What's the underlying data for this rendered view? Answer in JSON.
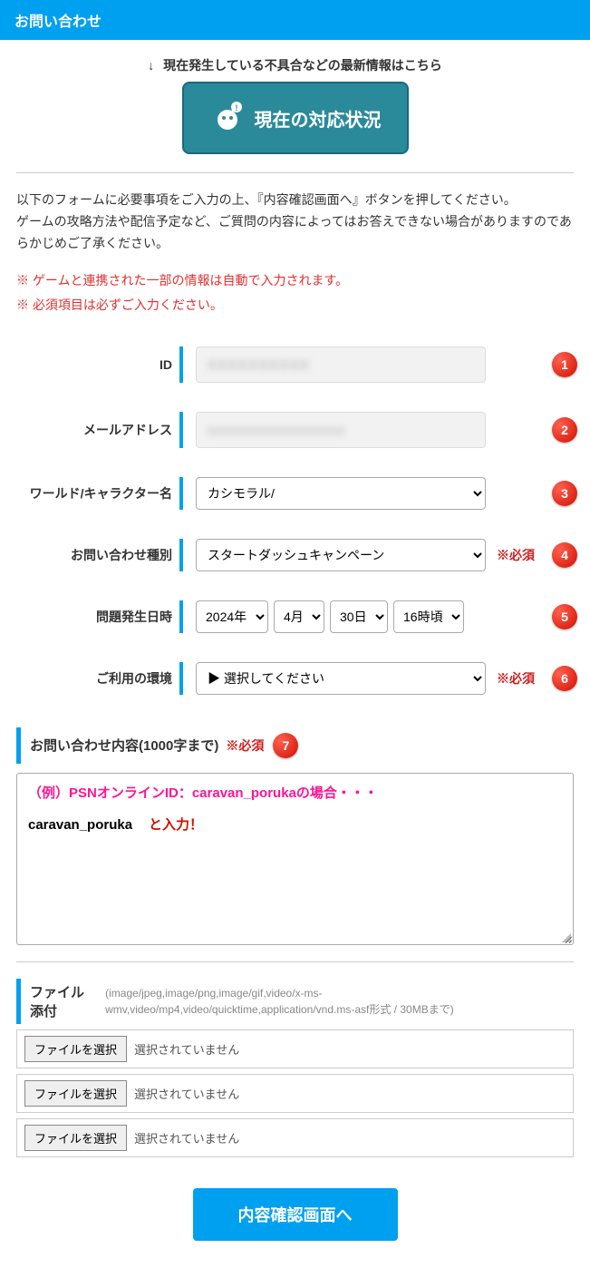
{
  "header": {
    "title": "お問い合わせ"
  },
  "notice": {
    "arrow": "↓",
    "text": "現在発生している不具合などの最新情報はこちら",
    "button": "現在の対応状況"
  },
  "instructions": {
    "line1": "以下のフォームに必要事項をご入力の上、『内容確認画面へ』ボタンを押してください。",
    "line2": "ゲームの攻略方法や配信予定など、ご質問の内容によってはお答えできない場合がありますのであらかじめご了承ください。"
  },
  "red_notes": {
    "line1": "※ ゲームと連携された一部の情報は自動で入力されます。",
    "line2": "※ 必須項目は必ずご入力ください。"
  },
  "fields": {
    "id": {
      "label": "ID",
      "value": "XXXXXXXXXX",
      "badge": "1"
    },
    "email": {
      "label": "メールアドレス",
      "value": "xxxxxxxxxxxxxxxxx",
      "badge": "2"
    },
    "world": {
      "label": "ワールド/キャラクター名",
      "value": "カシモラル/",
      "badge": "3"
    },
    "category": {
      "label": "お問い合わせ種別",
      "value": "スタートダッシュキャンペーン",
      "required": "※必須",
      "badge": "4"
    },
    "date": {
      "label": "問題発生日時",
      "year": "2024年",
      "month": "4月",
      "day": "30日",
      "hour": "16時頃",
      "badge": "5"
    },
    "env": {
      "label": "ご利用の環境",
      "value": "▶ 選択してください",
      "required": "※必須",
      "badge": "6"
    }
  },
  "content_section": {
    "title": "お問い合わせ内容(1000字まで)",
    "required": "※必須",
    "badge": "7",
    "example_prefix": "（例）PSNオンラインID：caravan_porukaの場合・・・",
    "example_value": "caravan_poruka",
    "example_hint": "と入力！"
  },
  "attach_section": {
    "title": "ファイル添付",
    "hint": "(image/jpeg,image/png,image/gif,video/x-ms-wmv,video/mp4,video/quicktime,application/vnd.ms-asf形式 / 30MBまで)",
    "choose_label": "ファイルを選択",
    "none_label": "選択されていません"
  },
  "submit": {
    "label": "内容確認画面へ"
  }
}
